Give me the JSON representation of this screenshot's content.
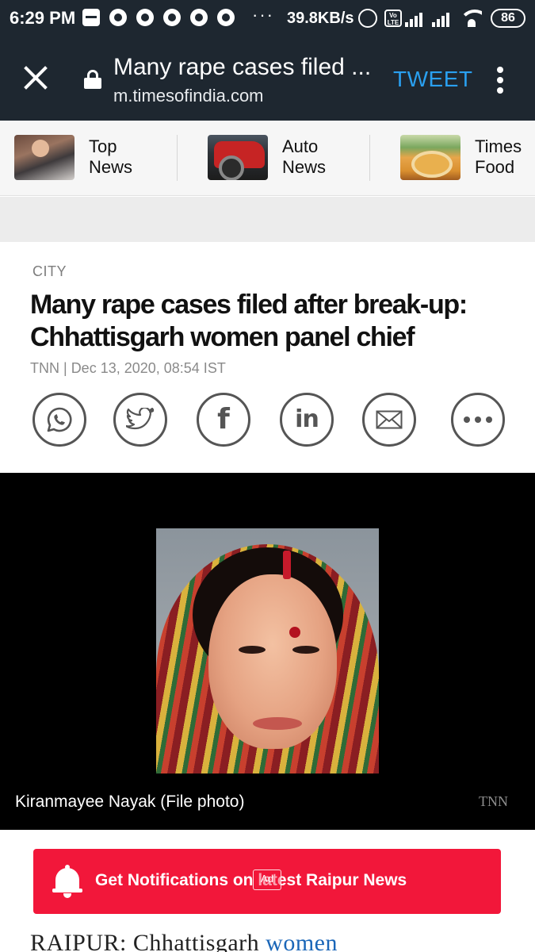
{
  "status_bar": {
    "time": "6:29 PM",
    "net_speed": "39.8KB/s",
    "volte": "Vo LTE",
    "battery": "86"
  },
  "browser": {
    "page_title": "Many rape cases filed ...",
    "url": "m.timesofindia.com",
    "tweet_label": "TWEET"
  },
  "categories": [
    {
      "label": "Top News",
      "icon": "top-news-thumbnail"
    },
    {
      "label": "Auto News",
      "icon": "auto-news-thumbnail"
    },
    {
      "label": "Times Food",
      "icon": "times-food-thumbnail"
    }
  ],
  "article": {
    "section": "CITY",
    "headline": "Many rape cases filed after break-up: Chhattisgarh women panel chief",
    "source": "TNN",
    "date": "Dec 13, 2020, 08:54 IST",
    "image_caption": "Kiranmayee Nayak (File photo)",
    "image_credit": "TNN",
    "body_start": "RAIPUR: Chhattisgarh ",
    "body_link": "women"
  },
  "share": [
    {
      "name": "whatsapp",
      "icon": "whatsapp-icon"
    },
    {
      "name": "twitter",
      "icon": "twitter-icon"
    },
    {
      "name": "facebook",
      "icon": "facebook-icon",
      "glyph": "f"
    },
    {
      "name": "linkedin",
      "icon": "linkedin-icon",
      "glyph": "in"
    },
    {
      "name": "email",
      "icon": "mail-icon"
    },
    {
      "name": "more",
      "icon": "more-icon"
    }
  ],
  "notification": {
    "label": "Get Notifications on latest Raipur News",
    "ad_badge": "Ad"
  },
  "colors": {
    "toolbar_bg": "#1e2730",
    "tweet_blue": "#2aa0f0",
    "notification_red": "#f2173a",
    "link_blue": "#1a66b8"
  }
}
